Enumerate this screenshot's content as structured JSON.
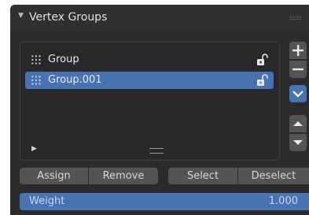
{
  "panel": {
    "title": "Vertex Groups"
  },
  "groups": [
    {
      "name": "Group",
      "selected": false,
      "icon": "vertex-group-icon",
      "lock_icon": "unlock-icon"
    },
    {
      "name": "Group.001",
      "selected": true,
      "icon": "vertex-group-icon",
      "lock_icon": "unlock-icon"
    }
  ],
  "side_buttons": {
    "add_icon": "plus-icon",
    "remove_icon": "minus-icon",
    "specials_icon": "chevron-down-icon",
    "move_up_icon": "triangle-up-icon",
    "move_down_icon": "triangle-down-icon"
  },
  "actions": {
    "assign": "Assign",
    "remove": "Remove",
    "select": "Select",
    "deselect": "Deselect"
  },
  "weight": {
    "label": "Weight",
    "value": "1.000"
  },
  "colors": {
    "accent": "#4772b3",
    "panel_bg": "#2b2b2b",
    "button_bg": "#545454"
  }
}
